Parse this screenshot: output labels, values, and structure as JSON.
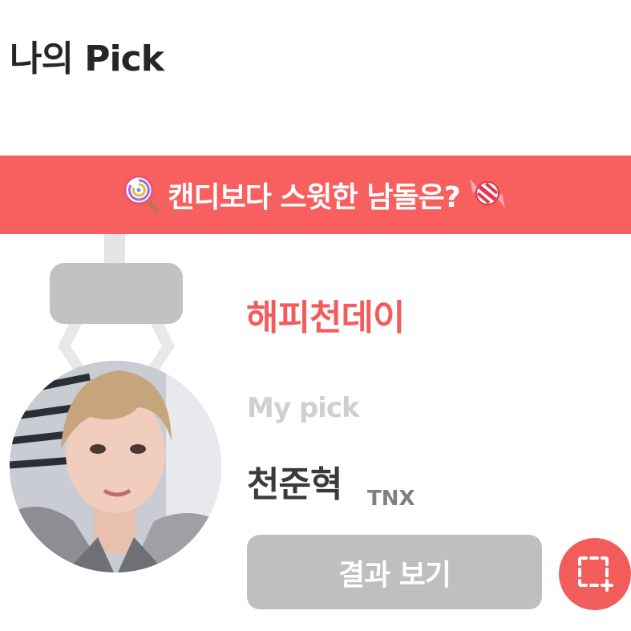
{
  "header": {
    "title": "나의 Pick"
  },
  "banner": {
    "text": "캔디보다 스윗한 남돌은?",
    "left_icon": "lollipop-icon",
    "right_icon": "candy-icon",
    "color": "#f7605f"
  },
  "poll": {
    "title": "해피천데이"
  },
  "pick": {
    "label": "My pick",
    "name": "천준혁",
    "group": "TNX"
  },
  "actions": {
    "result_label": "결과 보기",
    "capture_icon": "screenshot-icon"
  },
  "colors": {
    "accent": "#f25d5c",
    "button_disabled": "#bfbfbf"
  }
}
